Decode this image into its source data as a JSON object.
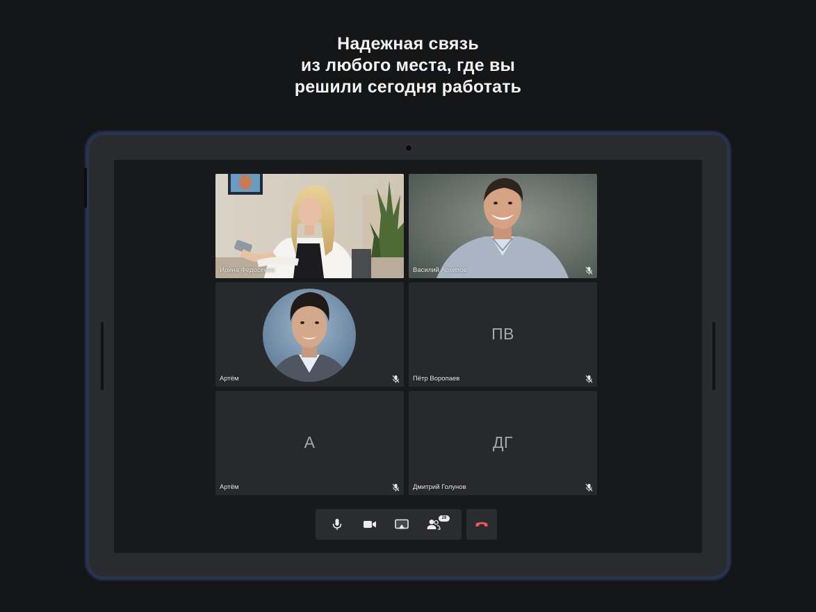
{
  "promo": {
    "line1": "Надежная связь",
    "line2": "из любого места, где вы",
    "line3": "решили сегодня работать"
  },
  "colors": {
    "background": "#141517",
    "tablet_frame": "#2a2b2e",
    "tile": "#28292d",
    "speaking_border": "#3ccf6b",
    "hangup_red": "#ee5a57"
  },
  "participants": [
    {
      "name": "Ирина Федосеева",
      "initials": "",
      "speaking": true,
      "video": true,
      "muted": false
    },
    {
      "name": "Василий Архипов",
      "initials": "",
      "speaking": false,
      "video": true,
      "muted": true
    },
    {
      "name": "Артём",
      "initials": "",
      "speaking": false,
      "video": false,
      "avatar": true,
      "muted": true
    },
    {
      "name": "Пётр Воропаев",
      "initials": "ПВ",
      "speaking": false,
      "video": false,
      "muted": true
    },
    {
      "name": "Артём",
      "initials": "А",
      "speaking": false,
      "video": false,
      "muted": true
    },
    {
      "name": "Дмитрий Голунов",
      "initials": "ДГ",
      "speaking": false,
      "video": false,
      "muted": true
    }
  ],
  "toolbar": {
    "mic_icon": "microphone-icon",
    "camera_icon": "video-camera-icon",
    "screen_share_icon": "screen-share-icon",
    "participants_icon": "participants-icon",
    "participants_count": "28",
    "hangup_icon": "phone-hangup-icon"
  }
}
